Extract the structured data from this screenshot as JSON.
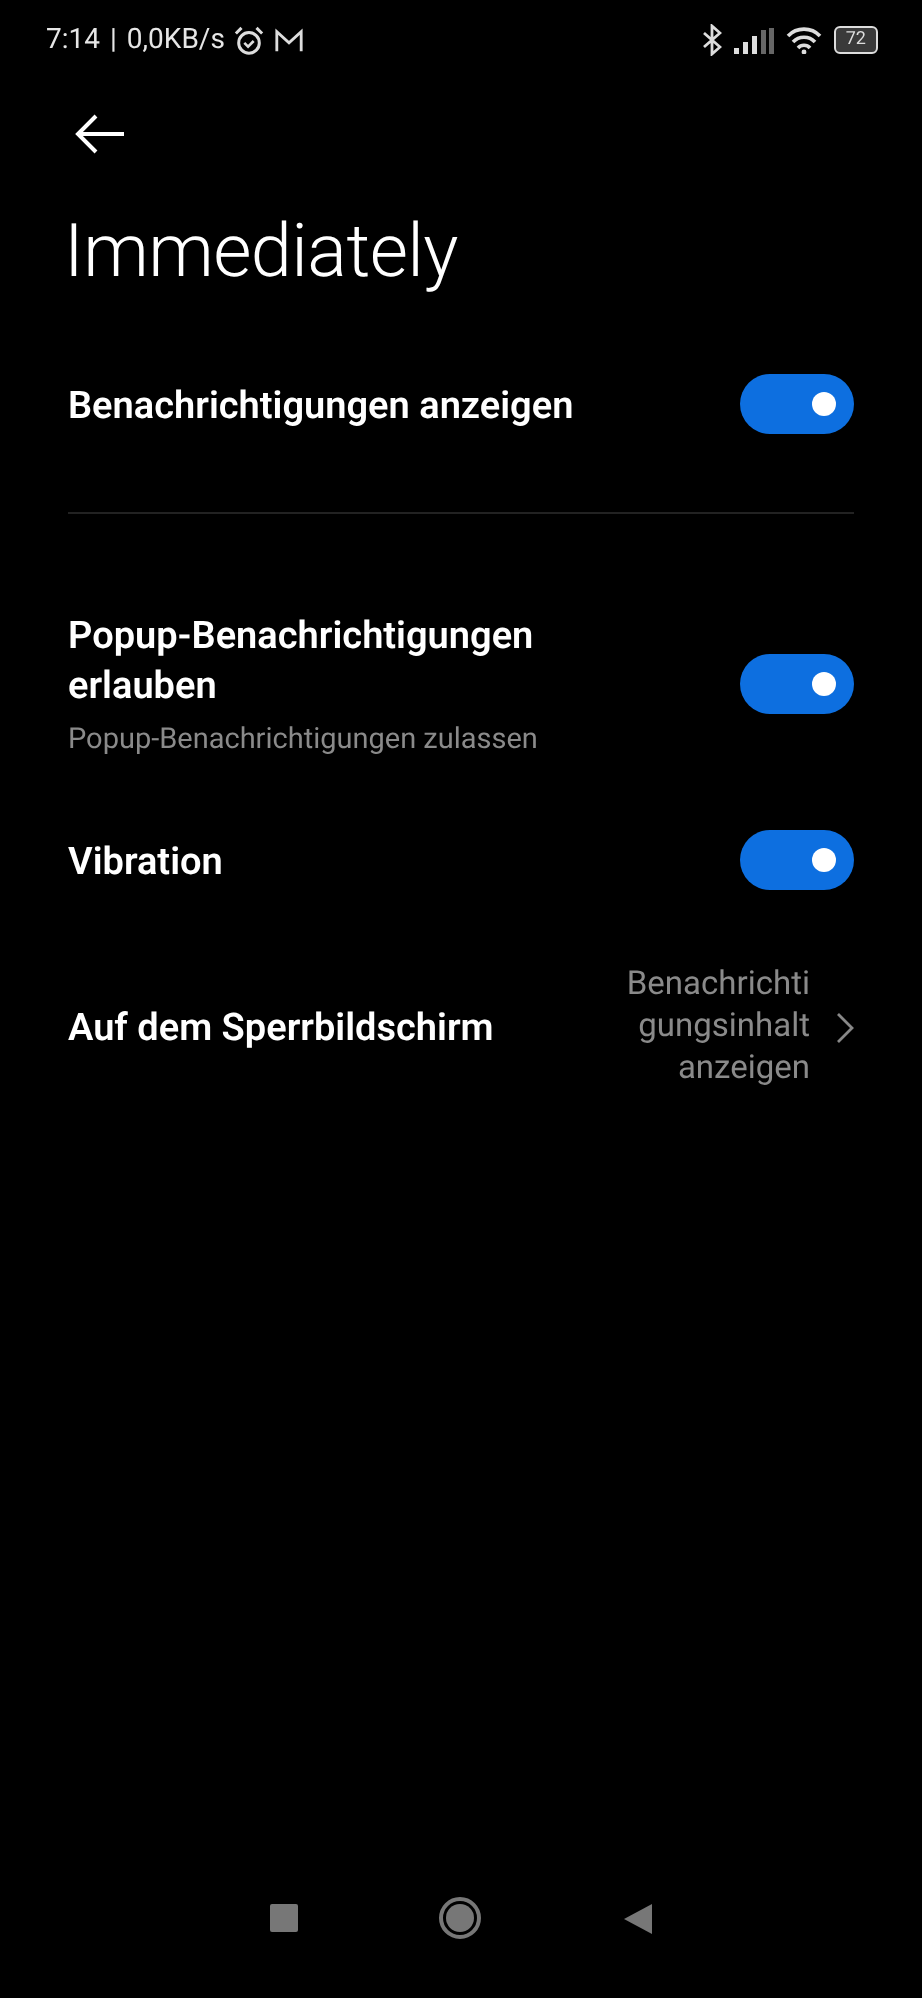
{
  "status_bar": {
    "time": "7:14",
    "separator": "|",
    "network_speed": "0,0KB/s",
    "battery": "72"
  },
  "title": "Immediately",
  "settings": [
    {
      "kind": "toggle",
      "label": "Benachrichtigungen anzeigen",
      "on": true,
      "divider_after": true
    },
    {
      "kind": "toggle",
      "label": "Popup-Benachrichtigungen erlauben",
      "subtitle": "Popup-Benachrichtigungen zulassen",
      "on": true
    },
    {
      "kind": "toggle",
      "label": "Vibration",
      "on": true
    },
    {
      "kind": "link",
      "label": "Auf dem Sperrbildschirm",
      "value": "Benachrichtigungsinhalt anzeigen"
    }
  ]
}
